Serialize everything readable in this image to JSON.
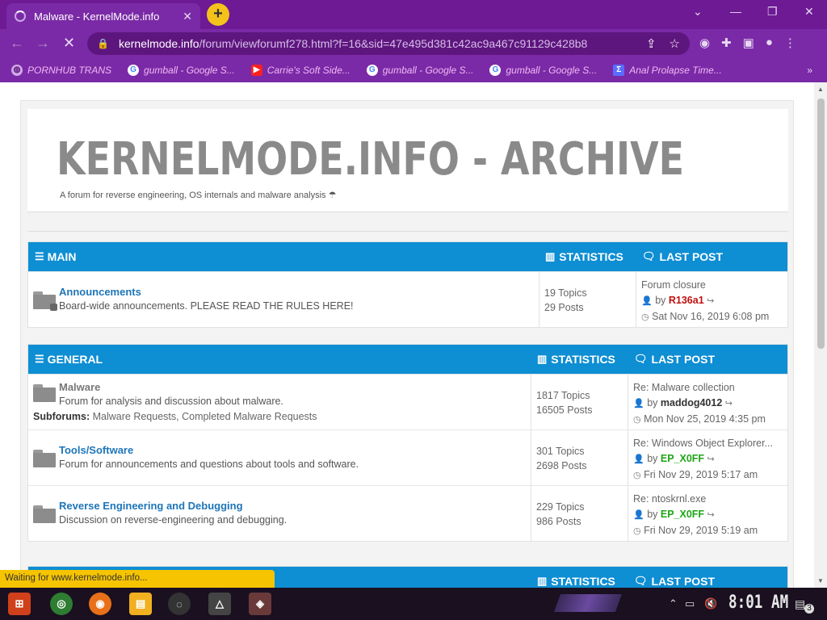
{
  "browser": {
    "tab_title": "Malware - KernelMode.info",
    "tab_close": "✕",
    "new_tab": "+",
    "url_host": "kernelmode.info",
    "url_path": "/forum/viewforumf278.html?f=16&sid=47e495d381c42ac9a467c91129c428b8",
    "bookmarks": [
      {
        "label": "PORNHUB TRANS",
        "icon": "globe-icon",
        "color": "#cfa9e6"
      },
      {
        "label": "gumball - Google S...",
        "icon": "google-icon",
        "color": "#ffffff"
      },
      {
        "label": "Carrie's Soft Side...",
        "icon": "youtube-icon",
        "color": "#ff2020"
      },
      {
        "label": "gumball - Google S...",
        "icon": "google-icon",
        "color": "#ffffff"
      },
      {
        "label": "gumball - Google S...",
        "icon": "google-icon",
        "color": "#ffffff"
      },
      {
        "label": "Anal Prolapse Time...",
        "icon": "sigma-icon",
        "color": "#5a6cff"
      }
    ],
    "bookmarks_more": "»",
    "status": "Waiting for www.kernelmode.info..."
  },
  "site": {
    "title": "KERNELMODE.INFO - ARCHIVE",
    "description": "A forum for reverse engineering, OS internals and malware analysis ☂"
  },
  "sections": [
    {
      "title": "MAIN",
      "stats_header": "STATISTICS",
      "last_header": "LAST POST",
      "rows": [
        {
          "title": "Announcements",
          "description": "Board-wide announcements. PLEASE READ THE RULES HERE!",
          "topics": "19 Topics",
          "posts": "29 Posts",
          "last_title": "Forum closure",
          "by": "by",
          "last_user": "R136a1",
          "last_date": "Sat Nov 16, 2019 6:08 pm"
        }
      ]
    },
    {
      "title": "GENERAL",
      "stats_header": "STATISTICS",
      "last_header": "LAST POST",
      "rows": [
        {
          "title": "Malware",
          "description": "Forum for analysis and discussion about malware.",
          "subforums_label": "Subforums:",
          "subforums": "Malware Requests, Completed Malware Requests",
          "topics": "1817 Topics",
          "posts": "16505 Posts",
          "last_title": "Re: Malware collection",
          "by": "by",
          "last_user": "maddog4012",
          "last_date": "Mon Nov 25, 2019 4:35 pm"
        },
        {
          "title": "Tools/Software",
          "description": "Forum for announcements and questions about tools and software.",
          "topics": "301 Topics",
          "posts": "2698 Posts",
          "last_title": "Re: Windows Object Explorer...",
          "by": "by",
          "last_user": "EP_X0FF",
          "last_date": "Fri Nov 29, 2019 5:17 am"
        },
        {
          "title": "Reverse Engineering and Debugging",
          "description": "Discussion on reverse-engineering and debugging.",
          "topics": "229 Topics",
          "posts": "986 Posts",
          "last_title": "Re: ntoskrnl.exe",
          "by": "by",
          "last_user": "EP_X0FF",
          "last_date": "Fri Nov 29, 2019 5:19 am"
        }
      ]
    },
    {
      "title": "",
      "stats_header": "STATISTICS",
      "last_header": "LAST POST"
    }
  ],
  "taskbar": {
    "clock": "8:01 AM",
    "notifications": "3"
  },
  "colors": {
    "chrome_purple": "#7a2aa6",
    "forum_header_blue": "#0e8ed3",
    "link_blue": "#1e75b8",
    "user_red": "#c01010",
    "user_green": "#1ea516"
  }
}
